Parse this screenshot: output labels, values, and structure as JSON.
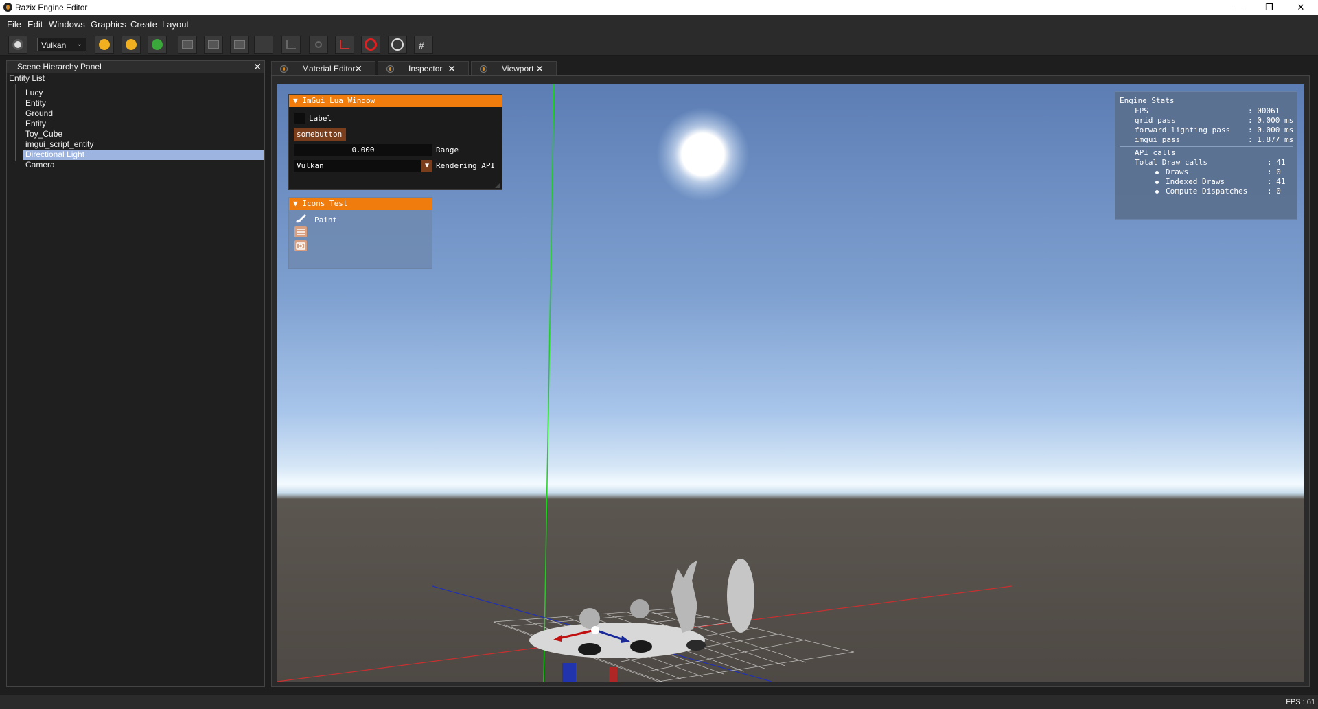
{
  "window": {
    "title": "Razix Engine Editor",
    "minimize": "—",
    "maximize": "❐",
    "close": "✕"
  },
  "menu": [
    "File",
    "Edit",
    "Windows",
    "Graphics",
    "Create",
    "Layout"
  ],
  "toolbar": {
    "api_select_value": "Vulkan",
    "icons": [
      "settings-icon",
      "api-dropdown",
      "scene-icon-1",
      "scene-icon-2",
      "add-entity-icon",
      "clapper-icon-1",
      "clapper-icon-2",
      "clapper-icon-3",
      "blank-icon",
      "translate-gizmo-icon",
      "rotate-gizmo-icon",
      "scale-gizmo-icon",
      "no-entry-icon",
      "globe-icon",
      "grid-icon"
    ],
    "colors": {
      "accent_red": "#e02020",
      "accent_green": "#3aa83a",
      "accent_yellow": "#f0b020"
    }
  },
  "hierarchy": {
    "title": "Scene Hierarchy Panel",
    "list_title": "Entity List",
    "entities": [
      "Lucy",
      "Entity",
      "Ground",
      "Entity",
      "Toy_Cube",
      "imgui_script_entity",
      "Directional Light",
      "Camera"
    ],
    "selected_index": 6
  },
  "tabs": [
    {
      "label": "Material Editor",
      "close": "✕"
    },
    {
      "label": "Inspector",
      "close": "✕"
    },
    {
      "label": "Viewport",
      "close": "✕"
    }
  ],
  "lua_window": {
    "title": "ImGui Lua Window",
    "checkbox_label": "Label",
    "button_label": "somebutton",
    "slider_value": "0.000",
    "slider_label": "Range",
    "combo_value": "Vulkan",
    "combo_label": "Rendering API"
  },
  "icons_window": {
    "title": "Icons Test",
    "paint_label": "Paint",
    "icons": [
      "paint-brush-icon",
      "layers-icon",
      "camera-icon"
    ]
  },
  "stats": {
    "title": "Engine Stats",
    "rows": [
      {
        "key": "FPS",
        "value": ": 00061"
      },
      {
        "key": "grid pass",
        "value": ": 0.000 ms"
      },
      {
        "key": "forward lighting pass",
        "value": ": 0.000 ms"
      },
      {
        "key": "imgui pass",
        "value": ": 1.877 ms"
      }
    ],
    "api_calls": "API calls",
    "total_draw_calls": {
      "key": "Total Draw calls",
      "value": ": 41"
    },
    "sub_rows": [
      {
        "key": "Draws",
        "value": ": 0"
      },
      {
        "key": "Indexed Draws",
        "value": ": 41"
      },
      {
        "key": "Compute Dispatches",
        "value": ": 0"
      }
    ]
  },
  "status": {
    "fps": "FPS : 61"
  },
  "colors": {
    "selection": "#9db3e0",
    "imgui_orange": "#f07c0e",
    "imgui_button": "#7a3e1c"
  }
}
